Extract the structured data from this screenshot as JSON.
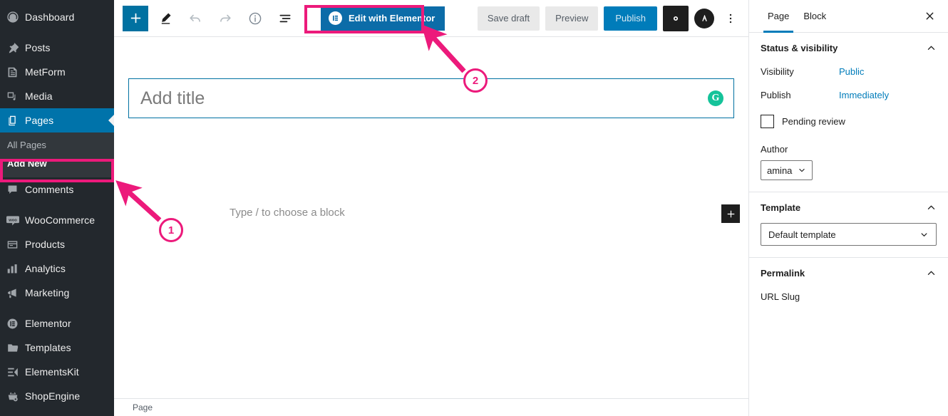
{
  "sidebar": {
    "items": [
      {
        "label": "Dashboard",
        "icon": "dashboard-icon",
        "name": "sidebar-item-dashboard"
      },
      {
        "label": "Posts",
        "icon": "pin-icon",
        "name": "sidebar-item-posts"
      },
      {
        "label": "MetForm",
        "icon": "form-icon",
        "name": "sidebar-item-metform"
      },
      {
        "label": "Media",
        "icon": "media-icon",
        "name": "sidebar-item-media"
      },
      {
        "label": "Pages",
        "icon": "pages-icon",
        "name": "sidebar-item-pages"
      },
      {
        "label": "Comments",
        "icon": "comment-icon",
        "name": "sidebar-item-comments"
      },
      {
        "label": "WooCommerce",
        "icon": "woocommerce-icon",
        "name": "sidebar-item-woocommerce"
      },
      {
        "label": "Products",
        "icon": "products-icon",
        "name": "sidebar-item-products"
      },
      {
        "label": "Analytics",
        "icon": "analytics-icon",
        "name": "sidebar-item-analytics"
      },
      {
        "label": "Marketing",
        "icon": "megaphone-icon",
        "name": "sidebar-item-marketing"
      },
      {
        "label": "Elementor",
        "icon": "elementor-icon",
        "name": "sidebar-item-elementor"
      },
      {
        "label": "Templates",
        "icon": "folder-icon",
        "name": "sidebar-item-templates"
      },
      {
        "label": "ElementsKit",
        "icon": "elementskit-icon",
        "name": "sidebar-item-elementskit"
      },
      {
        "label": "ShopEngine",
        "icon": "shopengine-icon",
        "name": "sidebar-item-shopengine"
      }
    ],
    "submenu": {
      "all_pages": "All Pages",
      "add_new": "Add New"
    },
    "current_item": "Pages",
    "active_subitem": "Add New",
    "colors": {
      "background": "#23282d",
      "submenu_background": "#32373c",
      "current": "#0073aa"
    }
  },
  "toolbar": {
    "add_block_label": "+",
    "edit_tool_name": "edit-icon",
    "undo_name": "undo-icon",
    "redo_name": "redo-icon",
    "details_name": "info-icon",
    "list_view_name": "list-view-icon",
    "elementor_button": "Edit with Elementor",
    "elementor_badge": "E",
    "save_draft": "Save draft",
    "preview": "Preview",
    "publish": "Publish",
    "settings_gear": "gear-icon",
    "plugin_logo": "astra-logo-icon",
    "more_options": "kebab-menu-icon",
    "colors": {
      "elementor_blue": "#0c6ca8",
      "publish_blue": "#007cba",
      "add_blue": "#0071a1"
    }
  },
  "editor": {
    "title_placeholder": "Add title",
    "title_value": "",
    "grammarly_letter": "G",
    "grammarly_color": "#15c39a",
    "paragraph_placeholder": "Type / to choose a block",
    "inserter_label": "+",
    "breadcrumb": "Page"
  },
  "settings_panel": {
    "tabs": [
      {
        "label": "Page",
        "active": true
      },
      {
        "label": "Block",
        "active": false
      }
    ],
    "close_label": "✕",
    "status": {
      "title": "Status & visibility",
      "visibility_label": "Visibility",
      "visibility_value": "Public",
      "publish_label": "Publish",
      "publish_value": "Immediately",
      "pending_review_label": "Pending review",
      "pending_review_checked": false,
      "author_label": "Author",
      "author_value": "amina"
    },
    "template": {
      "title": "Template",
      "selected": "Default template"
    },
    "permalink": {
      "title": "Permalink",
      "url_slug_label": "URL Slug"
    },
    "accent_color": "#007cba"
  },
  "annotations": {
    "color": "#ec1a7b",
    "markers": [
      {
        "number": "1",
        "name": "annotation-marker-1"
      },
      {
        "number": "2",
        "name": "annotation-marker-2"
      }
    ],
    "highlights": [
      {
        "name": "highlight-add-new"
      },
      {
        "name": "highlight-edit-with-elementor"
      }
    ]
  }
}
